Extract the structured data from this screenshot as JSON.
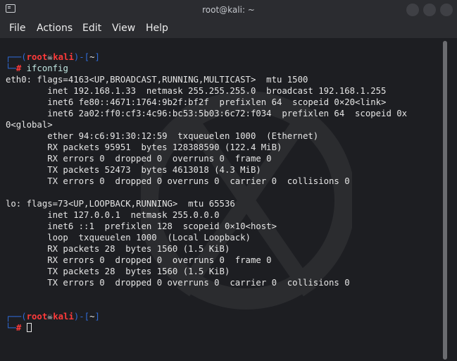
{
  "window": {
    "title": "root@kali: ~"
  },
  "menubar": {
    "items": [
      "File",
      "Actions",
      "Edit",
      "View",
      "Help"
    ]
  },
  "prompt1": {
    "open": "┌──(",
    "user": "root",
    "host": "kali",
    "close": ")-[",
    "path": "~",
    "end": "]",
    "line2_prefix": "└─",
    "hash": "#",
    "command": "ifconfig"
  },
  "output": [
    "eth0: flags=4163<UP,BROADCAST,RUNNING,MULTICAST>  mtu 1500",
    "        inet 192.168.1.33  netmask 255.255.255.0  broadcast 192.168.1.255",
    "        inet6 fe80::4671:1764:9b2f:bf2f  prefixlen 64  scopeid 0×20<link>",
    "        inet6 2a02:ff0:cf3:4c96:bc53:5b03:6c72:f034  prefixlen 64  scopeid 0x",
    "0<global>",
    "        ether 94:c6:91:30:12:59  txqueuelen 1000  (Ethernet)",
    "        RX packets 95951  bytes 128388590 (122.4 MiB)",
    "        RX errors 0  dropped 0  overruns 0  frame 0",
    "        TX packets 52473  bytes 4613018 (4.3 MiB)",
    "        TX errors 0  dropped 0 overruns 0  carrier 0  collisions 0",
    "",
    "lo: flags=73<UP,LOOPBACK,RUNNING>  mtu 65536",
    "        inet 127.0.0.1  netmask 255.0.0.0",
    "        inet6 ::1  prefixlen 128  scopeid 0×10<host>",
    "        loop  txqueuelen 1000  (Local Loopback)",
    "        RX packets 28  bytes 1560 (1.5 KiB)",
    "        RX errors 0  dropped 0  overruns 0  frame 0",
    "        TX packets 28  bytes 1560 (1.5 KiB)",
    "        TX errors 0  dropped 0 overruns 0  carrier 0  collisions 0"
  ],
  "prompt2": {
    "open": "┌──(",
    "user": "root",
    "host": "kali",
    "close": ")-[",
    "path": "~",
    "end": "]",
    "line2_prefix": "└─",
    "hash": "#"
  },
  "icons": {
    "app": "terminal-icon",
    "skull": "skull-icon",
    "cursor": "block-cursor"
  },
  "colors": {
    "prompt_blue": "#2f6bd8",
    "prompt_red": "#ff3a3a",
    "background": "#1d1e22"
  }
}
